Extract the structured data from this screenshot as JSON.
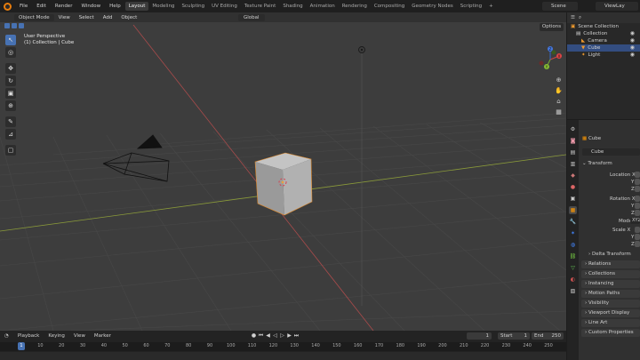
{
  "topbar": {
    "menus": [
      "File",
      "Edit",
      "Render",
      "Window",
      "Help"
    ],
    "workspaces": [
      "Layout",
      "Modeling",
      "Sculpting",
      "UV Editing",
      "Texture Paint",
      "Shading",
      "Animation",
      "Rendering",
      "Compositing",
      "Geometry Nodes",
      "Scripting"
    ],
    "active_workspace": "Layout",
    "add_tab": "+",
    "scene_name": "Scene",
    "view_layer": "ViewLay"
  },
  "viewport": {
    "mode": "Object Mode",
    "menus": [
      "View",
      "Select",
      "Add",
      "Object"
    ],
    "orientation": "Global",
    "options_label": "Options",
    "perspective": "User Perspective",
    "collection_path": "(1) Collection | Cube",
    "gizmo_axes": [
      "X",
      "Y",
      "Z"
    ]
  },
  "timeline": {
    "menus": [
      "Playback",
      "Keying",
      "View",
      "Marker"
    ],
    "current_frame": "1",
    "start_label": "Start",
    "start_value": "1",
    "end_label": "End",
    "end_value": "250",
    "ruler_ticks": [
      "1",
      "10",
      "20",
      "30",
      "40",
      "50",
      "60",
      "70",
      "80",
      "90",
      "100",
      "110",
      "120",
      "130",
      "140",
      "150",
      "160",
      "170",
      "180",
      "190",
      "200",
      "210",
      "220",
      "230",
      "240",
      "250"
    ]
  },
  "outliner": {
    "title": "Scene Collection",
    "items": [
      {
        "label": "Collection",
        "depth": 1
      },
      {
        "label": "Camera",
        "depth": 2
      },
      {
        "label": "Cube",
        "depth": 2
      },
      {
        "label": "Light",
        "depth": 2
      }
    ]
  },
  "properties": {
    "object_name": "Cube",
    "datablock_name": "Cube",
    "transform_label": "Transform",
    "location_label": "Location X",
    "rotation_label": "Rotation X",
    "mode_label": "Mode",
    "mode_value": "XYZ Euler",
    "scale_label": "Scale X",
    "axis_y": "Y",
    "axis_z": "Z",
    "panels": [
      "Delta Transform",
      "Relations",
      "Collections",
      "Instancing",
      "Motion Paths",
      "Visibility",
      "Viewport Display",
      "Line Art",
      "Custom Properties"
    ]
  },
  "colors": {
    "accent": "#4772b3",
    "x_axis": "#a84b4b",
    "y_axis": "#8a9a3a",
    "background": "#3d3d3d"
  }
}
